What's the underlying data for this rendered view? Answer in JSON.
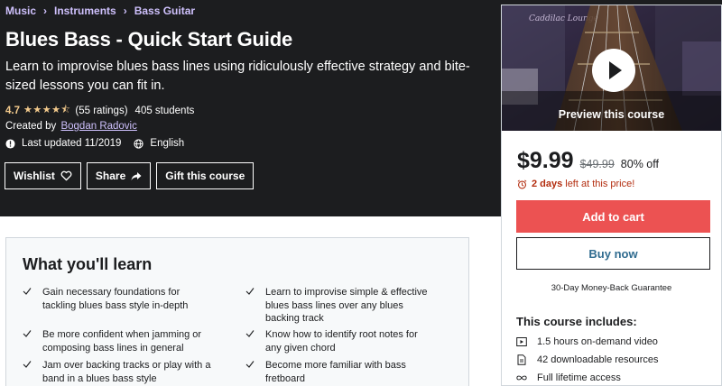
{
  "breadcrumb": [
    "Music",
    "Instruments",
    "Bass Guitar"
  ],
  "title": "Blues Bass - Quick Start Guide",
  "subtitle": "Learn to improvise blues bass lines using ridiculously effective strategy and bite-sized lessons you can fit in.",
  "rating": {
    "value": "4.7",
    "stars": "★★★★⯪",
    "count": "(55 ratings)",
    "students": "405 students"
  },
  "created_by": {
    "prefix": "Created by",
    "instructor": "Bogdan Radovic"
  },
  "meta": {
    "last_updated": "Last updated 11/2019",
    "language": "English"
  },
  "buttons": {
    "wishlist": "Wishlist",
    "share": "Share",
    "gift": "Gift this course"
  },
  "preview": {
    "label": "Preview this course"
  },
  "pricing": {
    "price": "$9.99",
    "original": "$49.99",
    "discount": "80% off",
    "timer_bold": "2 days",
    "timer_rest": "left at this price!"
  },
  "actions": {
    "add_to_cart": "Add to cart",
    "buy_now": "Buy now",
    "guarantee": "30-Day Money-Back Guarantee"
  },
  "includes": {
    "title": "This course includes:",
    "items": [
      {
        "icon": "video-icon",
        "label": "1.5 hours on-demand video"
      },
      {
        "icon": "file-icon",
        "label": "42 downloadable resources"
      },
      {
        "icon": "infinity-icon",
        "label": "Full lifetime access"
      }
    ]
  },
  "learn": {
    "title": "What you'll learn",
    "items": [
      "Gain necessary foundations for tackling blues bass style in-depth",
      "Learn to improvise simple & effective blues bass lines over any blues backing track",
      "Be more confident when jamming or composing bass lines in general",
      "Know how to identify root notes for any given chord",
      "Jam over backing tracks or play with a band in a blues bass style",
      "Become more familiar with bass fretboard"
    ]
  },
  "colors": {
    "hero_bg": "#1c1d1f",
    "link_purple": "#cec0fc",
    "star_gold": "#f3ca8c",
    "cart_red": "#ec5252",
    "timer_red": "#b32d0f"
  }
}
